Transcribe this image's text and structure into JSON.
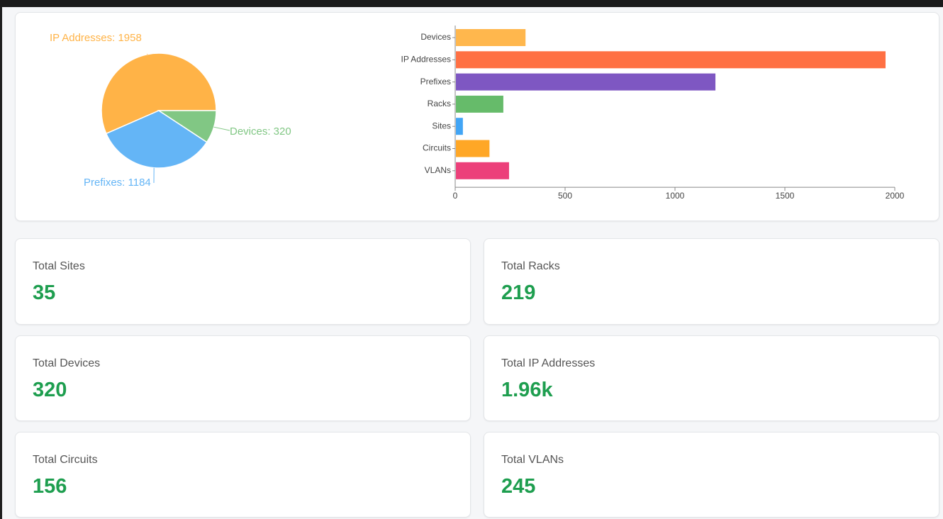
{
  "colors": {
    "accent_value": "#1e9e4f",
    "pie": [
      "#ffb347",
      "#64b5f6",
      "#81c784"
    ],
    "bars": [
      "#ffb74d",
      "#ff7043",
      "#7e57c2",
      "#66bb6a",
      "#42a5f5",
      "#ffa726",
      "#ec407a"
    ]
  },
  "chart_data": [
    {
      "type": "pie",
      "slices": [
        {
          "label": "IP Addresses: 1958",
          "value": 1958
        },
        {
          "label": "Prefixes: 1184",
          "value": 1184
        },
        {
          "label": "Devices: 320",
          "value": 320
        }
      ]
    },
    {
      "type": "bar",
      "orientation": "horizontal",
      "categories": [
        "Devices",
        "IP Addresses",
        "Prefixes",
        "Racks",
        "Sites",
        "Circuits",
        "VLANs"
      ],
      "values": [
        320,
        1958,
        1184,
        219,
        35,
        156,
        245
      ],
      "xlim": [
        0,
        2000
      ],
      "xticks": [
        "0",
        "500",
        "1000",
        "1500",
        "2000"
      ],
      "grid": false
    }
  ],
  "stats": [
    {
      "label": "Total Sites",
      "value": "35"
    },
    {
      "label": "Total Racks",
      "value": "219"
    },
    {
      "label": "Total Devices",
      "value": "320"
    },
    {
      "label": "Total IP Addresses",
      "value": "1.96k"
    },
    {
      "label": "Total Circuits",
      "value": "156"
    },
    {
      "label": "Total VLANs",
      "value": "245"
    }
  ]
}
